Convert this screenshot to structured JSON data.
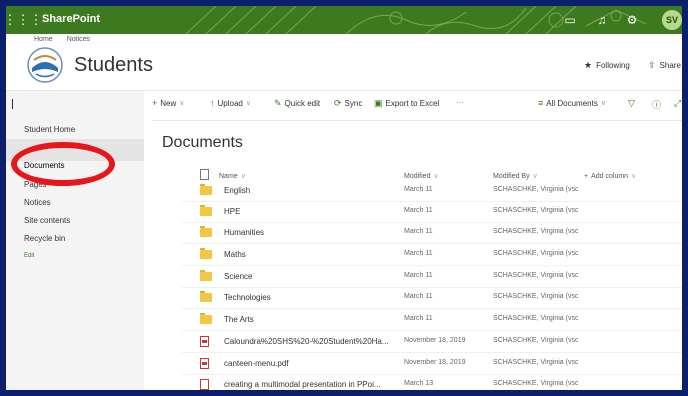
{
  "suitebar": {
    "app_name": "SharePoint",
    "avatar_initials": "SV",
    "brand_color": "#3d7a1f"
  },
  "breadcrumb": [
    "Home",
    "Notices"
  ],
  "site": {
    "title": "Students",
    "following_label": "Following",
    "share_label": "Share"
  },
  "leftnav": {
    "items": [
      "Student Home",
      "Documents",
      "Pages",
      "Notices",
      "Site contents",
      "Recycle bin"
    ],
    "edit_label": "Edit",
    "selected": "Documents"
  },
  "commandbar": {
    "new_label": "New",
    "upload_label": "Upload",
    "quick_edit_label": "Quick edit",
    "sync_label": "Sync",
    "export_label": "Export to Excel",
    "more_label": "···",
    "view_label": "All Documents"
  },
  "library": {
    "title": "Documents",
    "columns": {
      "name": "Name",
      "modified": "Modified",
      "modified_by": "Modified By",
      "add_column": "Add column"
    },
    "rows": [
      {
        "type": "folder",
        "name": "English",
        "modified": "March 11",
        "modified_by": "SCHASCHKE, Virginia (vsc"
      },
      {
        "type": "folder",
        "name": "HPE",
        "modified": "March 11",
        "modified_by": "SCHASCHKE, Virginia (vsc"
      },
      {
        "type": "folder",
        "name": "Humanities",
        "modified": "March 11",
        "modified_by": "SCHASCHKE, Virginia (vsc"
      },
      {
        "type": "folder",
        "name": "Maths",
        "modified": "March 11",
        "modified_by": "SCHASCHKE, Virginia (vsc"
      },
      {
        "type": "folder",
        "name": "Science",
        "modified": "March 11",
        "modified_by": "SCHASCHKE, Virginia (vsc"
      },
      {
        "type": "folder",
        "name": "Technologies",
        "modified": "March 11",
        "modified_by": "SCHASCHKE, Virginia (vsc"
      },
      {
        "type": "folder",
        "name": "The Arts",
        "modified": "March 11",
        "modified_by": "SCHASCHKE, Virginia (vsc"
      },
      {
        "type": "pdf",
        "name": "Caloundra%20SHS%20-%20Student%20Ha...",
        "modified": "November 18, 2019",
        "modified_by": "SCHASCHKE, Virginia (vsc"
      },
      {
        "type": "pdf",
        "name": "canteen-menu.pdf",
        "modified": "November 18, 2019",
        "modified_by": "SCHASCHKE, Virginia (vsc"
      },
      {
        "type": "ppt",
        "name": "creating a multimodal presentation in PPoi...",
        "modified": "March 13",
        "modified_by": "SCHASCHKE, Virginia (vsc"
      }
    ]
  },
  "annotation": {
    "highlight_color": "#e8161b"
  }
}
